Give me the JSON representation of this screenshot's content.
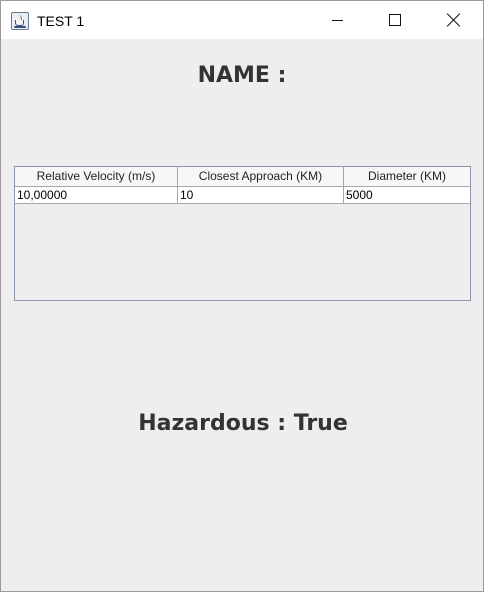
{
  "window": {
    "title": "TEST 1",
    "controls": {
      "minimize_icon": "minimize-icon",
      "maximize_icon": "maximize-icon",
      "close_icon": "close-icon"
    }
  },
  "content": {
    "name_label": "NAME :",
    "hazard_label": "Hazardous : True"
  },
  "table": {
    "columns": [
      "Relative Velocity (m/s)",
      "Closest Approach (KM)",
      "Diameter (KM)"
    ],
    "rows": [
      [
        "10,00000",
        "10",
        "5000"
      ]
    ]
  },
  "colors": {
    "window_bg": "#eeeeee",
    "titlebar_bg": "#ffffff",
    "label_text": "#333333",
    "table_border": "#8a97a8"
  }
}
